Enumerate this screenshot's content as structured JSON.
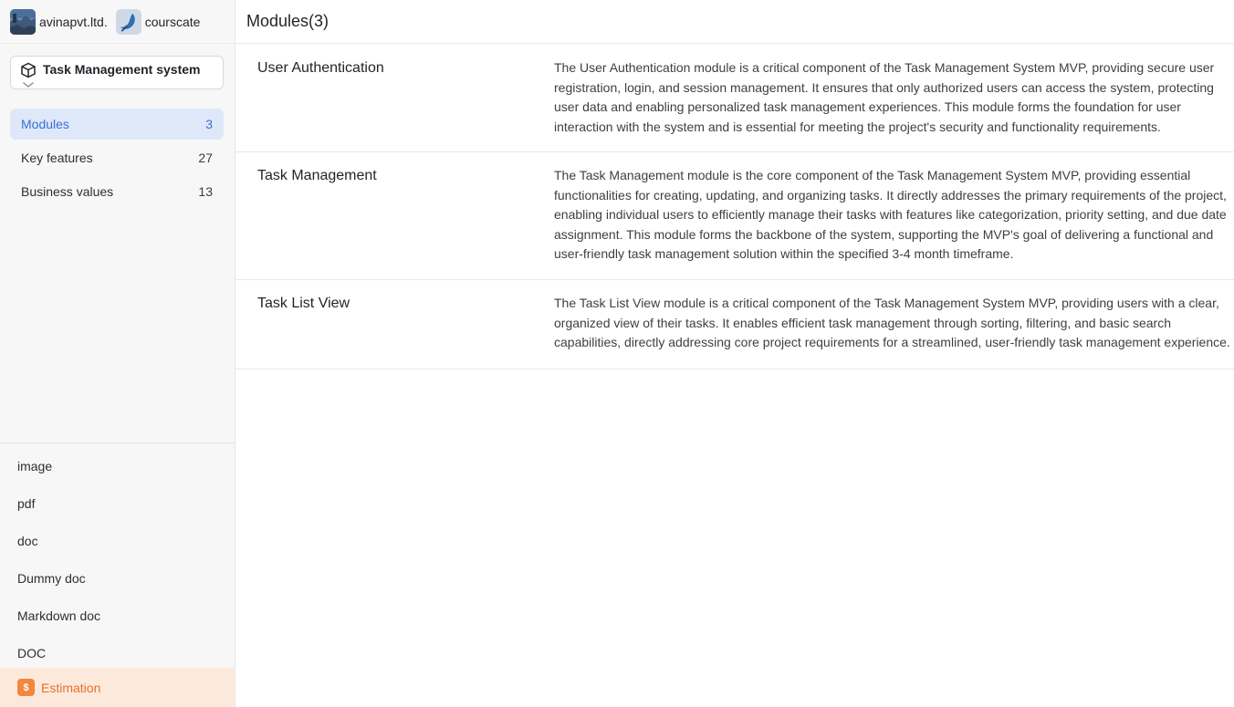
{
  "workspaces": [
    {
      "name": "avinapvt.ltd."
    },
    {
      "name": "courscate"
    }
  ],
  "project": {
    "name": "Task Management system"
  },
  "nav": [
    {
      "label": "Modules",
      "count": "3",
      "active": true
    },
    {
      "label": "Key features",
      "count": "27",
      "active": false
    },
    {
      "label": "Business values",
      "count": "13",
      "active": false
    }
  ],
  "docs": [
    "image",
    "pdf",
    "doc",
    "Dummy doc",
    "Markdown doc",
    "DOC"
  ],
  "estimation": {
    "label": "Estimation",
    "icon": "$"
  },
  "main": {
    "title": "Modules(3)",
    "modules": [
      {
        "name": "User Authentication",
        "lines": [
          "The User Authentication module is a critical component of the Task Management System MVP, providing secure user",
          "registration, login, and session management. It ensures that only authorized users can access the system, protecting",
          "user data and enabling personalized task management experiences. This module forms the foundation for user",
          "interaction with the system and is essential for meeting the project's security and functionality requirements."
        ]
      },
      {
        "name": "Task Management",
        "lines": [
          "The Task Management module is the core component of the Task Management System MVP, providing essential",
          "functionalities for creating, updating, and organizing tasks. It directly addresses the primary requirements of the project,",
          "enabling individual users to efficiently manage their tasks with features like categorization, priority setting, and due date",
          "assignment. This module forms the backbone of the system, supporting the MVP's goal of delivering a functional and",
          "user-friendly task management solution within the specified 3-4 month timeframe."
        ]
      },
      {
        "name": "Task List View",
        "lines": [
          "The Task List View module is a critical component of the Task Management System MVP, providing users with a clear,",
          "organized view of their tasks. It enables efficient task management through sorting, filtering, and basic search",
          "capabilities, directly addressing core project requirements for a streamlined, user-friendly task management experience."
        ]
      }
    ]
  }
}
